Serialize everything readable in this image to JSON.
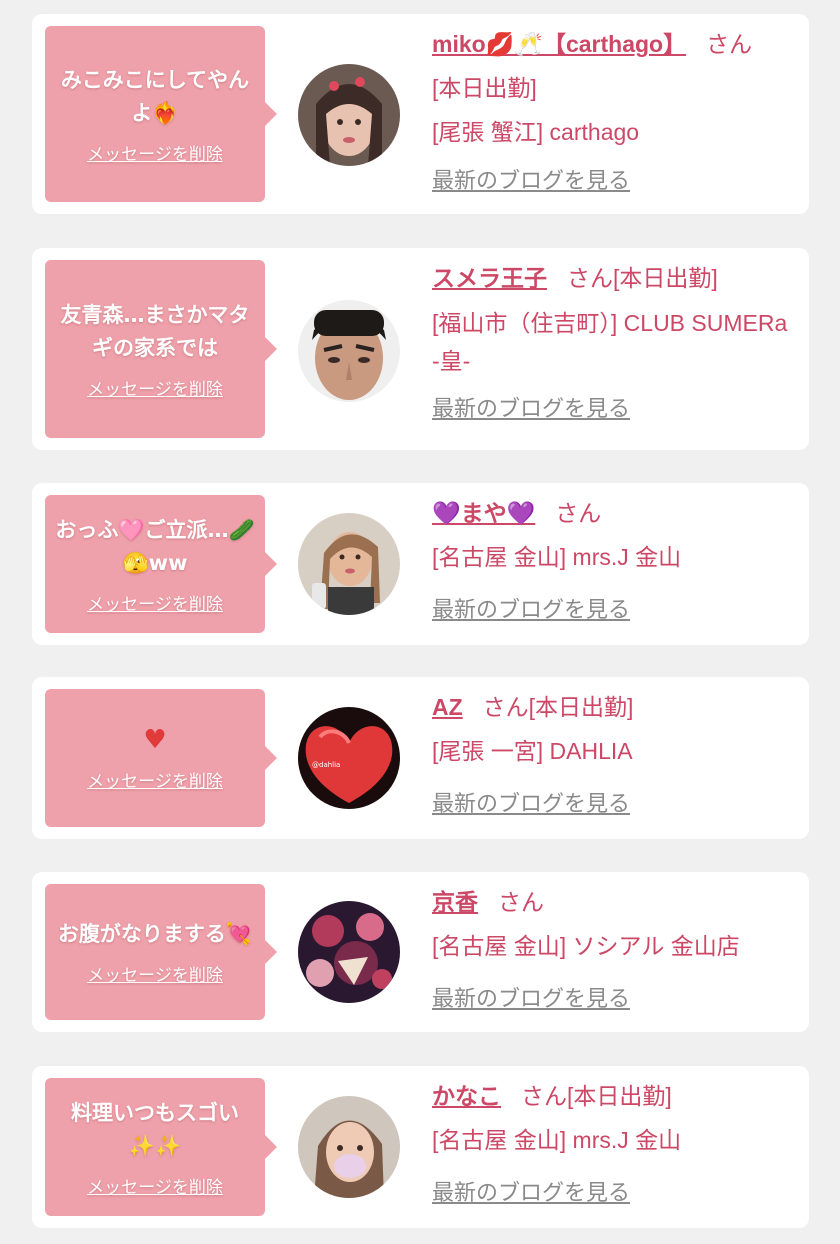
{
  "entries": [
    {
      "message": "みこみこにしてやんよ❤️‍🔥",
      "delete_label": "メッセージを削除",
      "name": "miko💋🥂【carthago】",
      "honorific": "さん",
      "status": "[本日出勤]",
      "shop": "[尾張 蟹江] carthago",
      "blog_label": "最新のブログを見る"
    },
    {
      "message": "友青森…まさかマタギの家系では",
      "delete_label": "メッセージを削除",
      "name": "スメラ王子",
      "honorific": "さん[本日出勤]",
      "shop": "[福山市（住吉町）] CLUB SUMERa -皇-",
      "blog_label": "最新のブログを見る"
    },
    {
      "message": "おっふ🩷ご立派…🥒🫣ww",
      "delete_label": "メッセージを削除",
      "name": "💜まや💜",
      "honorific": "さん",
      "shop": "[名古屋 金山] mrs.J 金山",
      "blog_label": "最新のブログを見る"
    },
    {
      "message": "♥",
      "delete_label": "メッセージを削除",
      "name": "AZ",
      "honorific": "さん[本日出勤]",
      "shop": "[尾張 一宮] DAHLIA",
      "blog_label": "最新のブログを見る"
    },
    {
      "message": "お腹がなりまする💘",
      "delete_label": "メッセージを削除",
      "name": "京香",
      "honorific": "さん",
      "shop": "[名古屋 金山] ソシアル 金山店",
      "blog_label": "最新のブログを見る"
    },
    {
      "message": "料理いつもスゴい✨✨",
      "delete_label": "メッセージを削除",
      "name": "かなこ",
      "honorific": "さん[本日出勤]",
      "shop": "[名古屋 金山] mrs.J 金山",
      "blog_label": "最新のブログを見る"
    }
  ],
  "colors": {
    "bubble": "#eea1aa",
    "accent": "#cc4866",
    "link_gray": "#8a8a8a",
    "background": "#f0f0f0"
  }
}
